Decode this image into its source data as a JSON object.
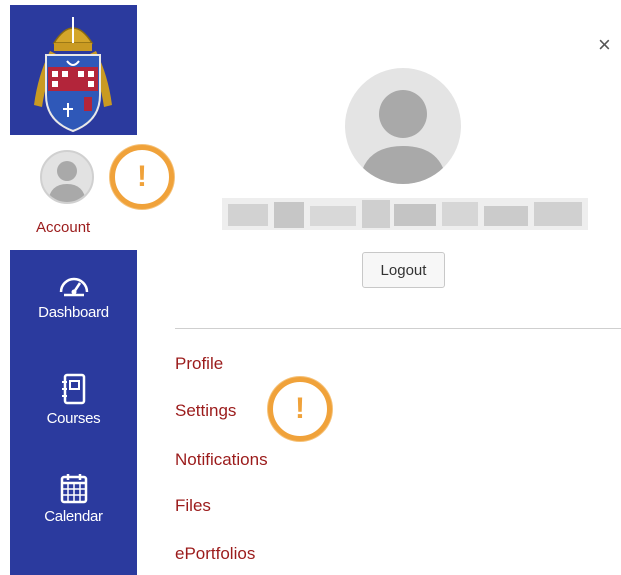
{
  "sidebar": {
    "account_label": "Account",
    "nav_items": [
      {
        "label": "Dashboard",
        "icon": "dashboard-icon"
      },
      {
        "label": "Courses",
        "icon": "courses-icon"
      },
      {
        "label": "Calendar",
        "icon": "calendar-icon"
      }
    ]
  },
  "tray": {
    "close_label": "×",
    "logout_label": "Logout",
    "links": [
      {
        "label": "Profile"
      },
      {
        "label": "Settings"
      },
      {
        "label": "Notifications"
      },
      {
        "label": "Files"
      },
      {
        "label": "ePortfolios"
      }
    ]
  },
  "callouts": {
    "symbol": "!"
  },
  "colors": {
    "sidebar_blue": "#2b3a9e",
    "link_red": "#9b1b1b",
    "callout_orange": "#f0a23a"
  }
}
